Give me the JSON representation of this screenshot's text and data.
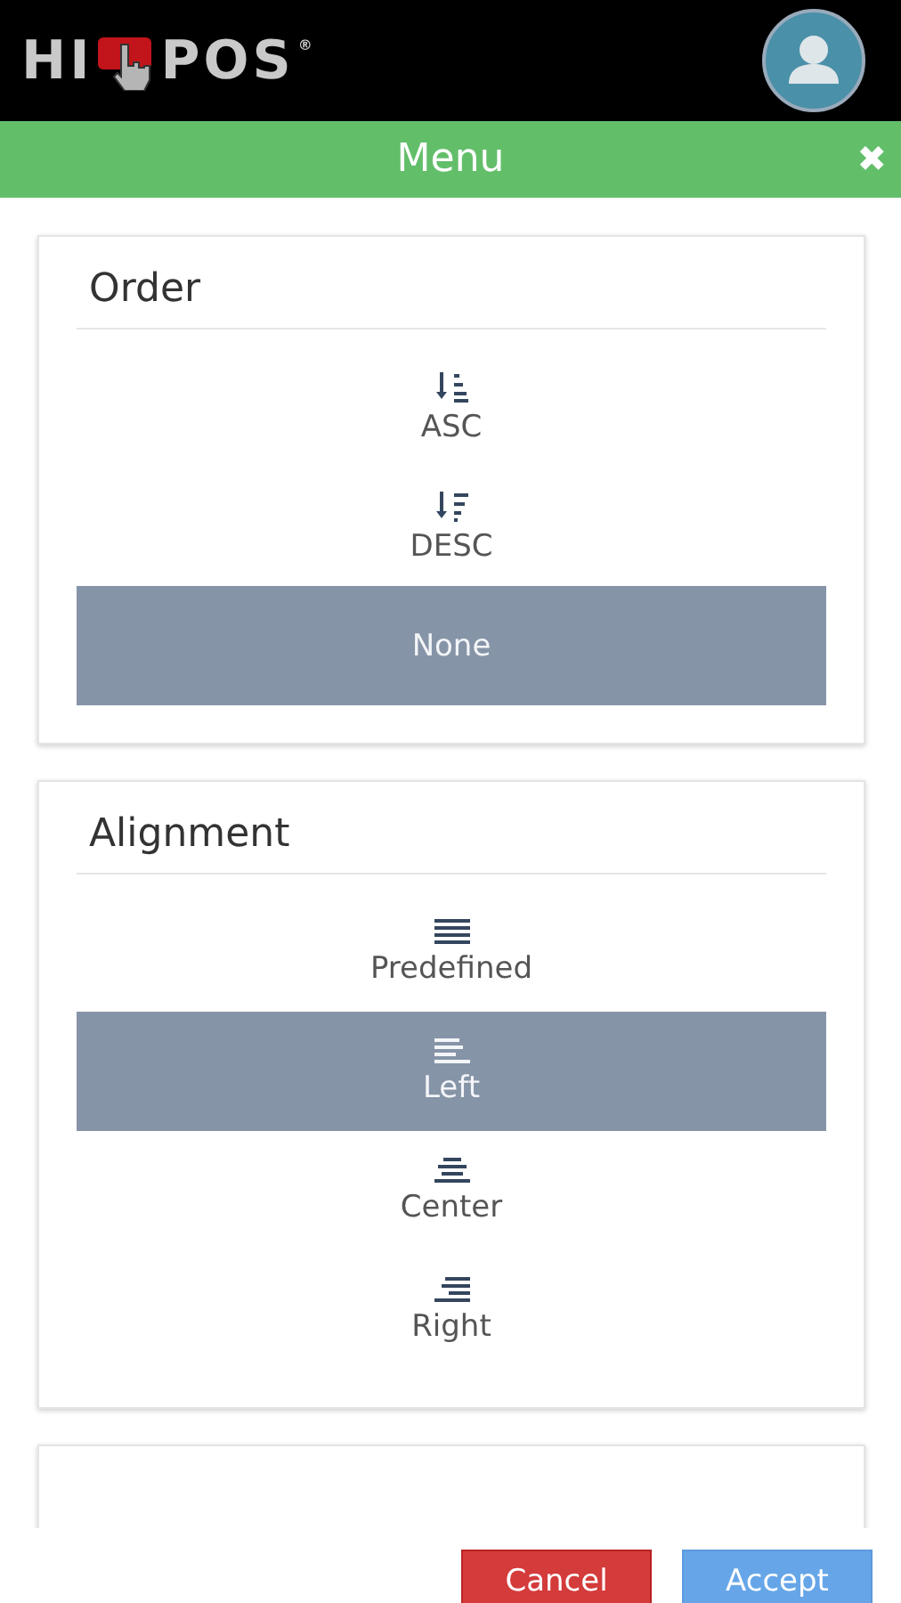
{
  "header": {
    "logo": {
      "left": "HI",
      "right": "POS",
      "mark": "®"
    }
  },
  "title_bar": {
    "title": "Menu",
    "close": "✖"
  },
  "sections": [
    {
      "title": "Order",
      "options": [
        {
          "kind": "asc",
          "label": "ASC",
          "selected": false
        },
        {
          "kind": "desc",
          "label": "DESC",
          "selected": false
        },
        {
          "kind": "none",
          "label": "None",
          "selected": true
        }
      ]
    },
    {
      "title": "Alignment",
      "options": [
        {
          "kind": "justify",
          "label": "Predefined",
          "selected": false
        },
        {
          "kind": "left",
          "label": "Left",
          "selected": true
        },
        {
          "kind": "center",
          "label": "Center",
          "selected": false
        },
        {
          "kind": "right",
          "label": "Right",
          "selected": false
        }
      ]
    },
    {
      "kind": "empty"
    }
  ],
  "buttons": [
    {
      "kind": "cancel",
      "label": "Cancel"
    },
    {
      "kind": "accept",
      "label": "Accept"
    }
  ]
}
